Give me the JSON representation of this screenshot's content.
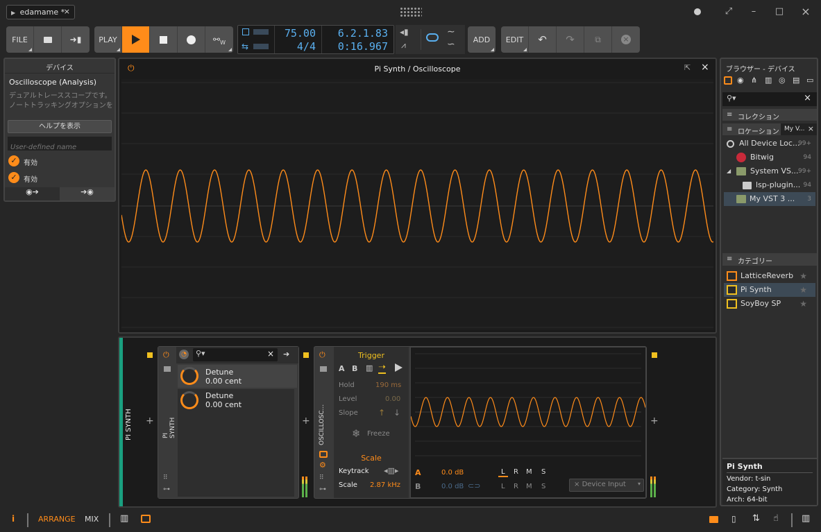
{
  "titlebar": {
    "tab_label": "edamame *",
    "tab_close": "×",
    "minimize": "–",
    "maximize": "□",
    "close": "×"
  },
  "toolbar": {
    "file": "FILE",
    "play": "PLAY",
    "add": "ADD",
    "edit": "EDIT",
    "tempo": "75.00",
    "signature": "4/4",
    "position": "6.2.1.83",
    "time": "0:16.967",
    "record_label": "W"
  },
  "device_panel": {
    "header": "デバイス",
    "name": "Oscilloscope (Analysis)",
    "desc_line1": "デュアルトレーススコープです。",
    "desc_line2": "ノートトラッキングオプションを",
    "help_button": "ヘルプを表示",
    "user_name_placeholder": "User-defined name",
    "check1": "有効",
    "check2": "有効"
  },
  "scope_window": {
    "title": "Pi Synth / Oscilloscope"
  },
  "chain": {
    "track_label": "PI SYNTH",
    "device1_label": "PI SYNTH",
    "param1_name": "Detune",
    "param1_value": "0.00 cent",
    "param2_name": "Detune",
    "param2_value": "0.00 cent",
    "device2_label": "OSCILLOSC...",
    "trigger_title": "Trigger",
    "ch_a": "A",
    "ch_b": "B",
    "hold_label": "Hold",
    "hold_value": "190 ms",
    "level_label": "Level",
    "level_value": "0.00",
    "slope_label": "Slope",
    "freeze_label": "Freeze",
    "scale_title": "Scale",
    "keytrack_label": "Keytrack",
    "scale_label": "Scale",
    "scale_value": "2.87 kHz",
    "a_label": "A",
    "a_db": "0.0 dB",
    "b_label": "B",
    "b_db": "0.0 dB",
    "l": "L",
    "r": "R",
    "m": "M",
    "s": "S",
    "device_input": "Device Input"
  },
  "browser": {
    "header": "ブラウザー - デバイス",
    "collection": "コレクション",
    "location": "ロケーション",
    "location_tab": "My V...",
    "locations": [
      {
        "label": "All Device Loc...",
        "count": "99+"
      },
      {
        "label": "Bitwig",
        "count": "94"
      },
      {
        "label": "System VS...",
        "count": "99+"
      },
      {
        "label": "lsp-plugin...",
        "count": "94"
      },
      {
        "label": "My VST 3 ...",
        "count": "3"
      }
    ],
    "category": "カテゴリー",
    "results": [
      {
        "label": "LatticeReverb"
      },
      {
        "label": "Pi Synth"
      },
      {
        "label": "SoyBoy SP"
      }
    ],
    "info_name": "Pi Synth",
    "info_vendor": "Vendor: t-sin",
    "info_category": "Category: Synth",
    "info_arch": "Arch: 64-bit"
  },
  "statusbar": {
    "info": "i",
    "arrange": "ARRANGE",
    "mix": "MIX"
  },
  "colors": {
    "accent": "#ff8c1a",
    "transport_text": "#5ab0f0",
    "track_color": "#1aa080",
    "selected_row": "#3d4a56"
  }
}
